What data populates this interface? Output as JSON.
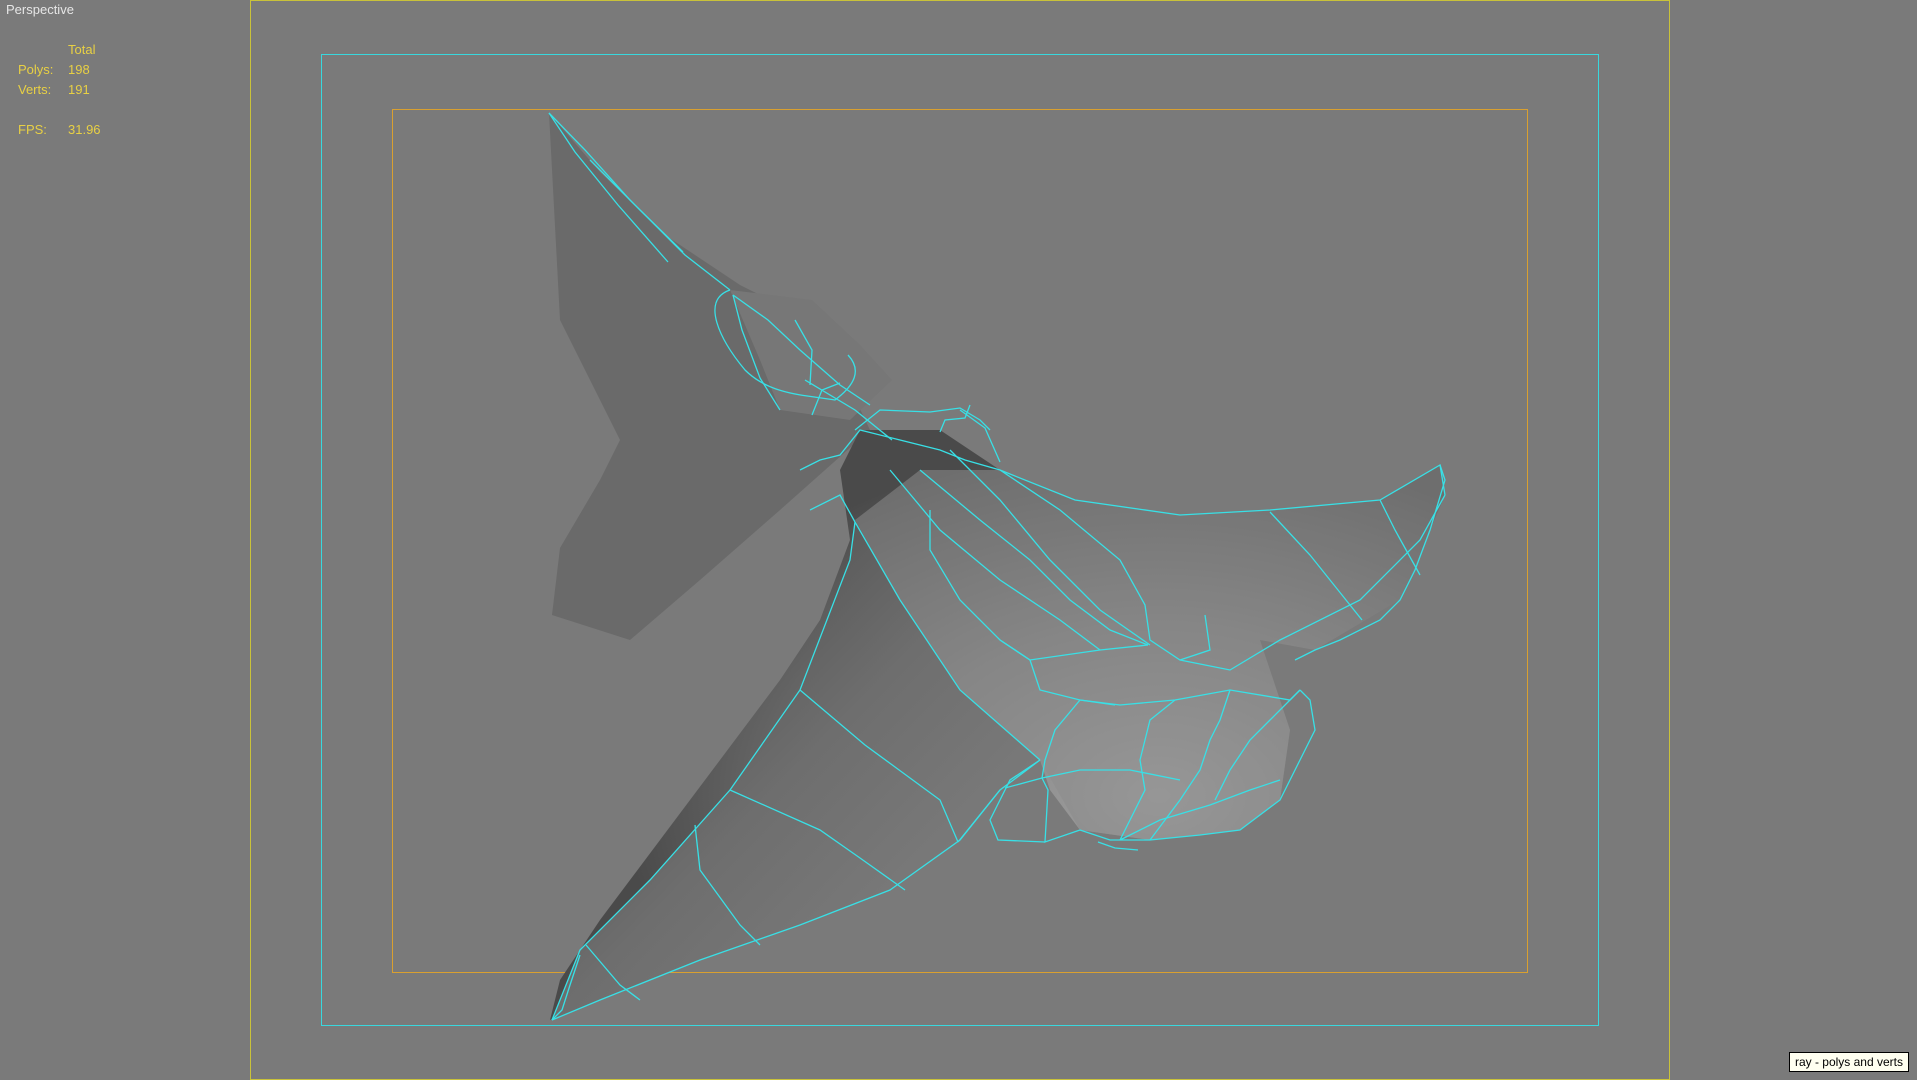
{
  "viewport": {
    "camera_label": "Perspective",
    "hud": {
      "column_header": "Total",
      "polys_label": "Polys:",
      "polys_value": "198",
      "verts_label": "Verts:",
      "verts_value": "191",
      "fps_label": "FPS:",
      "fps_value": "31.96"
    },
    "tooltip": "ray - polys and verts"
  },
  "colors": {
    "background": "#7a7a7a",
    "wireframe": "#38e0e6",
    "resolution_gate": "#c9c23a",
    "safe_action": "#38d8de",
    "safe_title": "#d9a030",
    "hud_text": "#e8d044"
  }
}
